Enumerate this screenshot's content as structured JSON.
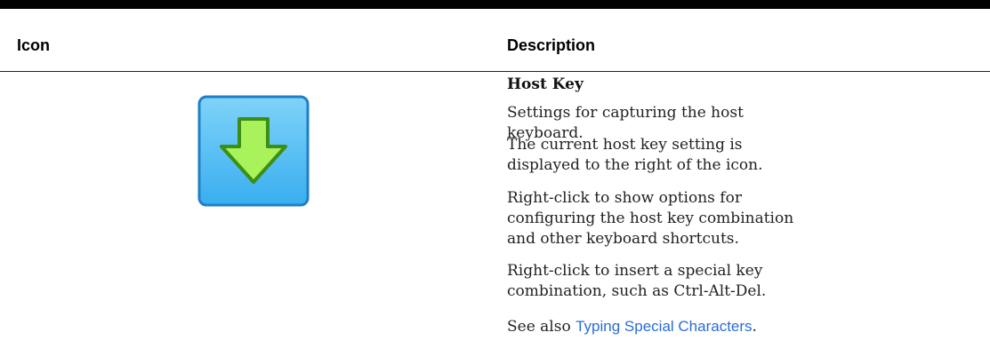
{
  "table": {
    "headers": {
      "icon": "Icon",
      "description": "Description"
    },
    "row": {
      "icon_name": "host-key-down-arrow-icon",
      "colors": {
        "icon_frame_top": "#6ac8f5",
        "icon_frame_bottom": "#3fb3ee",
        "arrow_fill": "#a8f25a",
        "arrow_stroke": "#3a8e11"
      },
      "title": "Host Key",
      "paragraphs": [
        "Settings for capturing the host keyboard.",
        "The current host key setting is displayed to the right of the icon.",
        "Right-click to show options for configuring the host key combination and other keyboard shortcuts.",
        "Right-click to insert a special key combination, such as Ctrl-Alt-Del."
      ],
      "see_also": {
        "prefix": "See also ",
        "link_text": "Typing Special Characters",
        "suffix": "."
      }
    }
  }
}
